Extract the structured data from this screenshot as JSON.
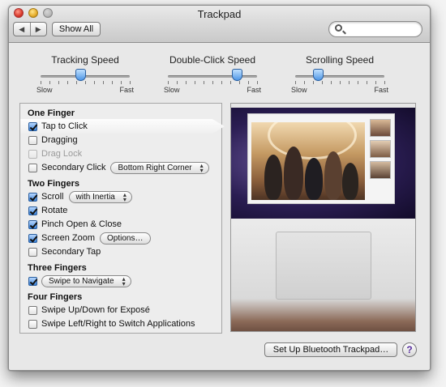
{
  "window": {
    "title": "Trackpad"
  },
  "toolbar": {
    "back_icon": "◀",
    "forward_icon": "▶",
    "show_all_label": "Show All",
    "search_value": "",
    "search_placeholder": ""
  },
  "sliders": [
    {
      "title": "Tracking Speed",
      "min_label": "Slow",
      "max_label": "Fast",
      "value": 0.45
    },
    {
      "title": "Double-Click Speed",
      "min_label": "Slow",
      "max_label": "Fast",
      "value": 0.78
    },
    {
      "title": "Scrolling Speed",
      "min_label": "Slow",
      "max_label": "Fast",
      "value": 0.26
    }
  ],
  "gestures": {
    "one_finger": {
      "heading": "One Finger",
      "tap_to_click": {
        "label": "Tap to Click",
        "checked": true
      },
      "dragging": {
        "label": "Dragging",
        "checked": false
      },
      "drag_lock": {
        "label": "Drag Lock",
        "checked": false,
        "enabled": false
      },
      "secondary_click": {
        "label": "Secondary Click",
        "checked": false,
        "popup": "Bottom Right Corner"
      }
    },
    "two_fingers": {
      "heading": "Two Fingers",
      "scroll": {
        "label": "Scroll",
        "checked": true,
        "popup": "with Inertia"
      },
      "rotate": {
        "label": "Rotate",
        "checked": true
      },
      "pinch": {
        "label": "Pinch Open & Close",
        "checked": true
      },
      "screen_zoom": {
        "label": "Screen Zoom",
        "checked": true,
        "button": "Options…"
      },
      "secondary_tap": {
        "label": "Secondary Tap",
        "checked": false
      }
    },
    "three_fingers": {
      "heading": "Three Fingers",
      "swipe": {
        "checked": true,
        "popup": "Swipe to Navigate"
      }
    },
    "four_fingers": {
      "heading": "Four Fingers",
      "expose": {
        "label": "Swipe Up/Down for Exposé",
        "checked": false
      },
      "switch_apps": {
        "label": "Swipe Left/Right to Switch Applications",
        "checked": false
      }
    }
  },
  "footer": {
    "bluetooth_label": "Set Up Bluetooth Trackpad…",
    "help_label": "?"
  },
  "colors": {
    "accent": "#3b82d8",
    "window_bg": "#e8e8e8"
  }
}
